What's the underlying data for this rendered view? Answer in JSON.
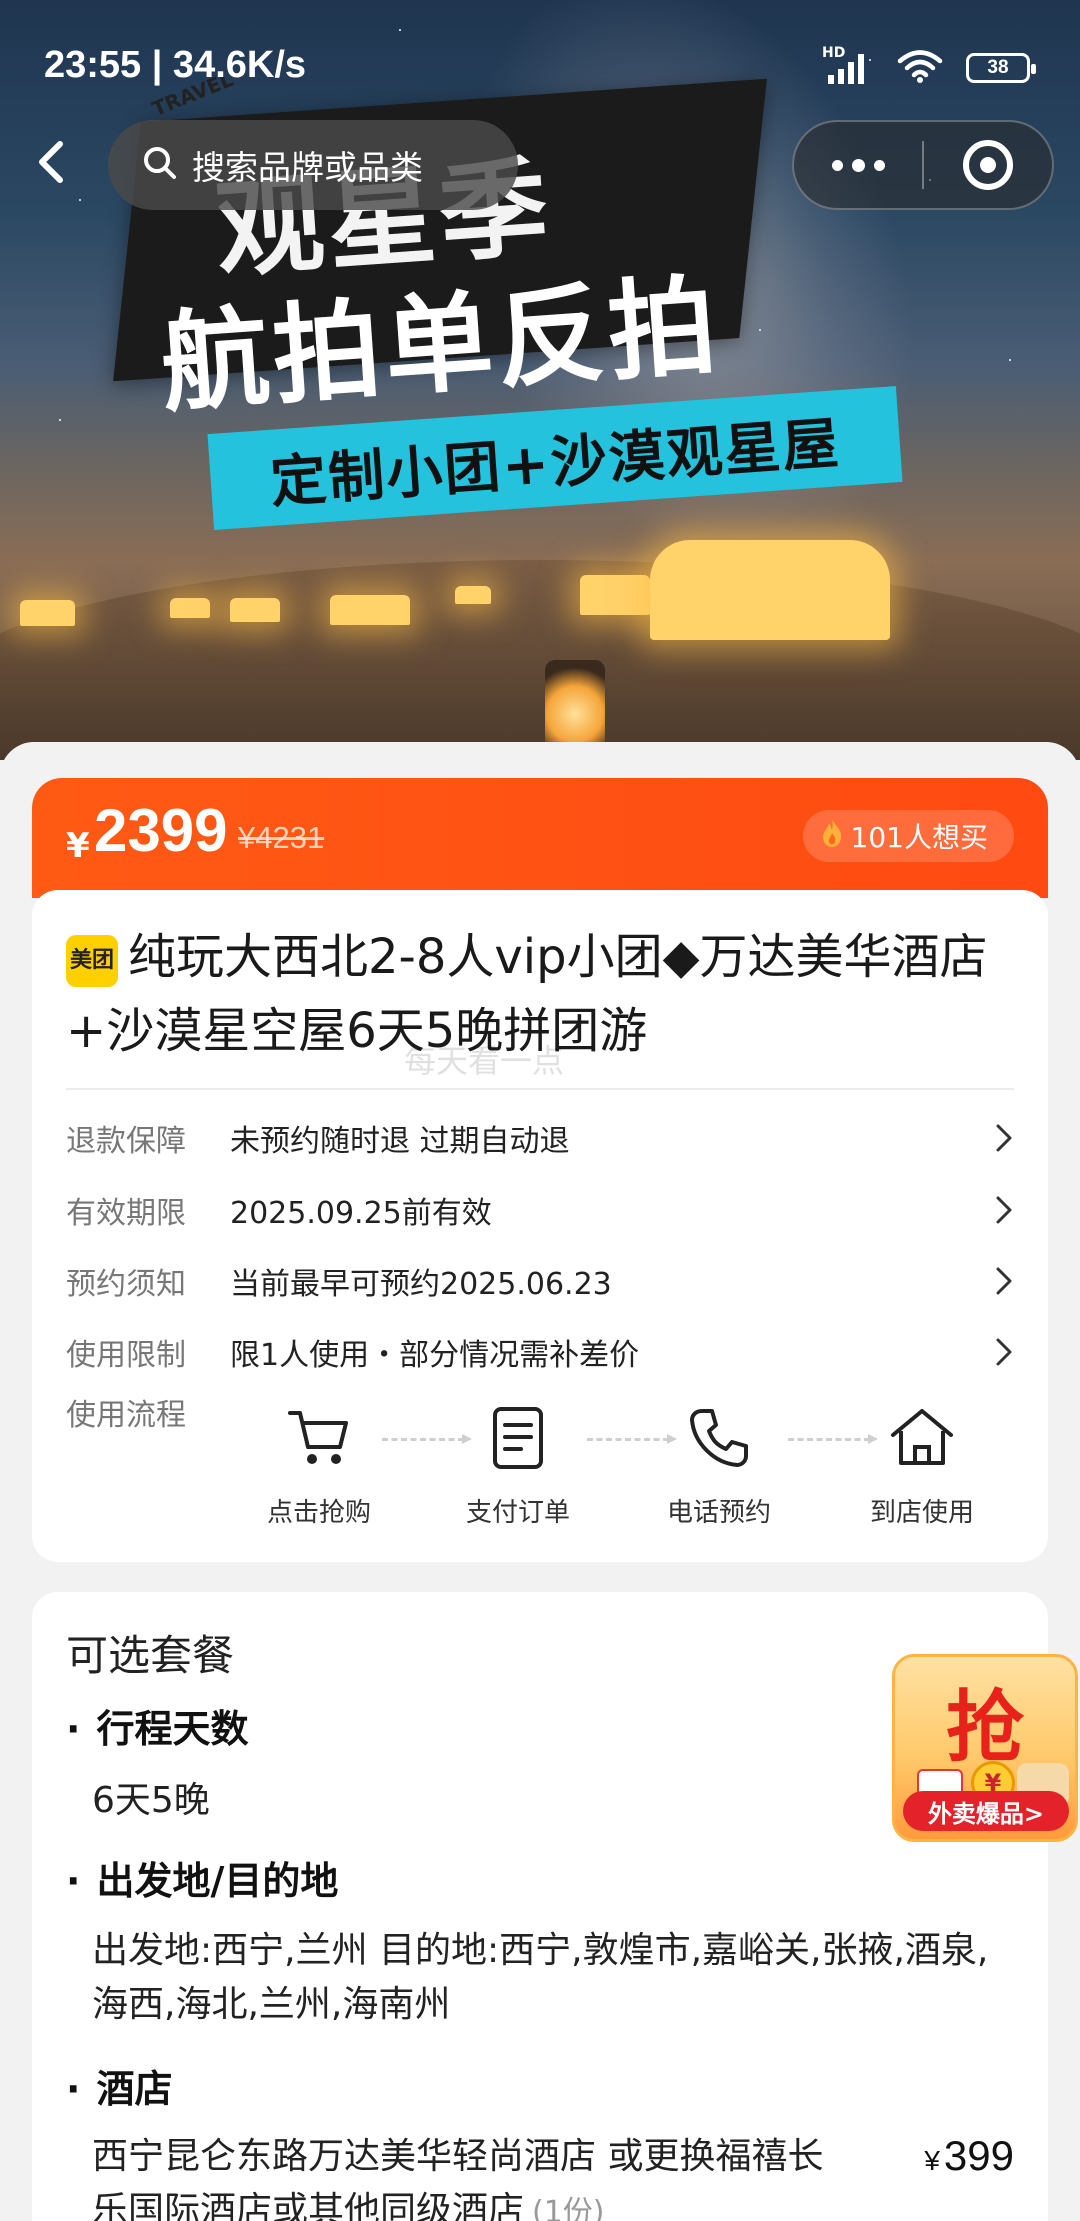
{
  "status_bar": {
    "time": "23:55 | 34.6K/s",
    "battery": "38",
    "signal_label": "HD"
  },
  "nav": {
    "search_placeholder": "搜索品牌或品类"
  },
  "banner": {
    "tag": "TRAVEL",
    "line1": "观星季",
    "line2": "航拍单反拍",
    "ribbon": "定制小团+沙漠观星屋"
  },
  "price": {
    "currency": "¥",
    "current": "2399",
    "original": "¥4231",
    "want_count": "101人想买"
  },
  "product": {
    "brand_badge": "美团",
    "title": "纯玩大西北2-8人vip小团◆万达美华酒店+沙漠星空屋6天5晚拼团游",
    "watermark": "每天看一点"
  },
  "details": [
    {
      "key": "退款保障",
      "value": "未预约随时退 过期自动退"
    },
    {
      "key": "有效期限",
      "value": "2025.09.25前有效"
    },
    {
      "key": "预约须知",
      "value": "当前最早可预约2025.06.23"
    },
    {
      "key": "使用限制",
      "value": "限1人使用・部分情况需补差价"
    }
  ],
  "flow": {
    "label": "使用流程",
    "steps": [
      {
        "label": "点击抢购",
        "icon": "cart-icon"
      },
      {
        "label": "支付订单",
        "icon": "document-icon"
      },
      {
        "label": "电话预约",
        "icon": "phone-icon"
      },
      {
        "label": "到店使用",
        "icon": "home-icon"
      }
    ]
  },
  "package": {
    "title": "可选套餐",
    "sections": [
      {
        "heading": "行程天数",
        "text": "6天5晚"
      },
      {
        "heading": "出发地/目的地",
        "text": "出发地:西宁,兰州 目的地:西宁,敦煌市,嘉峪关,张掖,酒泉,海西,海北,兰州,海南州"
      },
      {
        "heading": "酒店",
        "text": "西宁昆仑东路万达美华轻尚酒店 或更换福禧长乐国际酒店或其他同级酒店",
        "qty": "(1份)",
        "price_currency": "¥",
        "price": "399"
      }
    ]
  },
  "promo": {
    "big_char": "抢",
    "coin_char": "¥",
    "button": "外卖爆品>"
  },
  "colors": {
    "accent": "#ff4f13",
    "promo_red": "#e4222a",
    "brand_yellow": "#ffd000"
  }
}
